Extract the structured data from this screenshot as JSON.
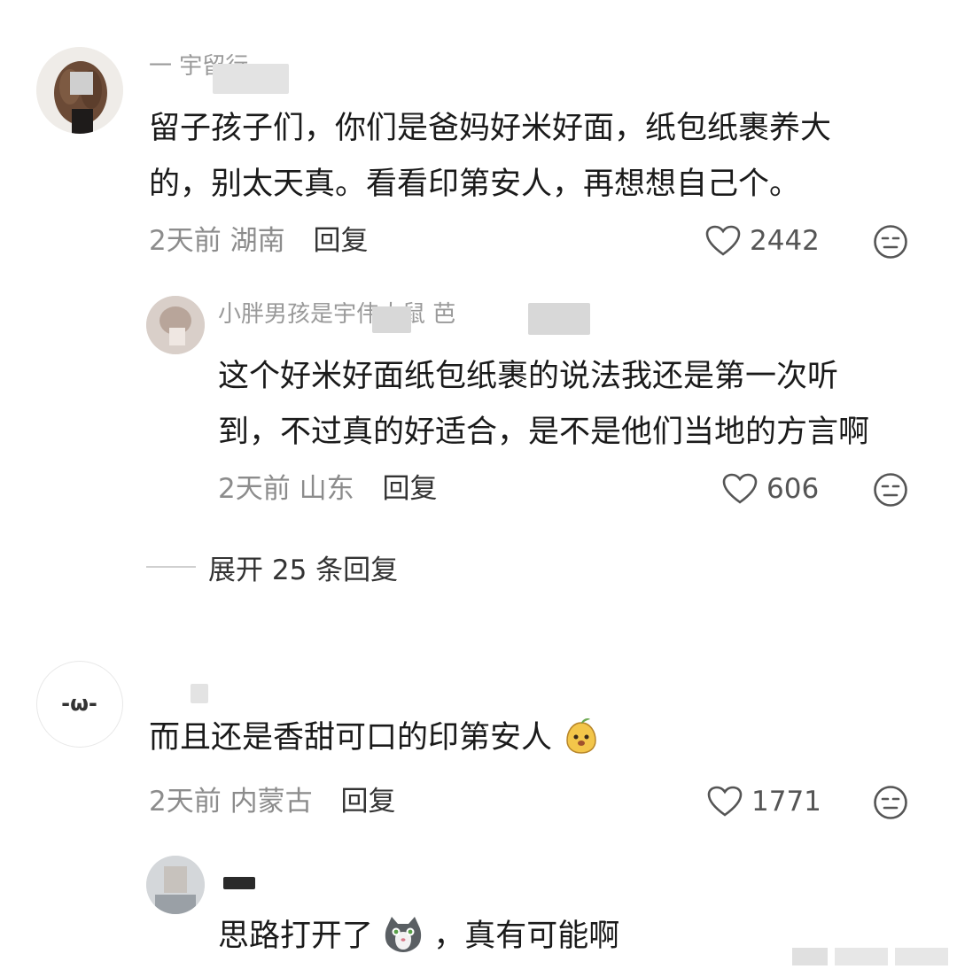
{
  "comments": [
    {
      "username": "一 宇留行",
      "text_lines": [
        "留子孩子们，你们是爸妈好米好面，纸包纸裹养大",
        "的，别太天真。看看印第安人，再想想自己个。"
      ],
      "time": "2天前",
      "location": "湖南",
      "reply_label": "回复",
      "likes": "2442"
    },
    {
      "username": "小胖男孩是宇伟大鼠 芭",
      "text_lines": [
        "这个好米好面纸包纸裹的说法我还是第一次听",
        "到，不过真的好适合，是不是他们当地的方言啊"
      ],
      "time": "2天前",
      "location": "山东",
      "reply_label": "回复",
      "likes": "606"
    },
    {
      "avatar_text": "-ω-",
      "text_lines": [
        "而且还是香甜可口的印第安人"
      ],
      "time": "2天前",
      "location": "内蒙古",
      "reply_label": "回复",
      "likes": "1771"
    },
    {
      "text_lines": [
        "思路打开了",
        "，真有可能啊"
      ]
    }
  ],
  "expand_label": "展开 25 条回复",
  "icons": {
    "like": "heart-outline-icon",
    "emoji": "neutral-face-icon",
    "inline_emoji_1": "pear-face-emoji",
    "inline_emoji_2": "cat-face-emoji"
  },
  "colors": {
    "text": "#1a1a1a",
    "meta": "#8c8c8c",
    "reply": "#333333"
  }
}
